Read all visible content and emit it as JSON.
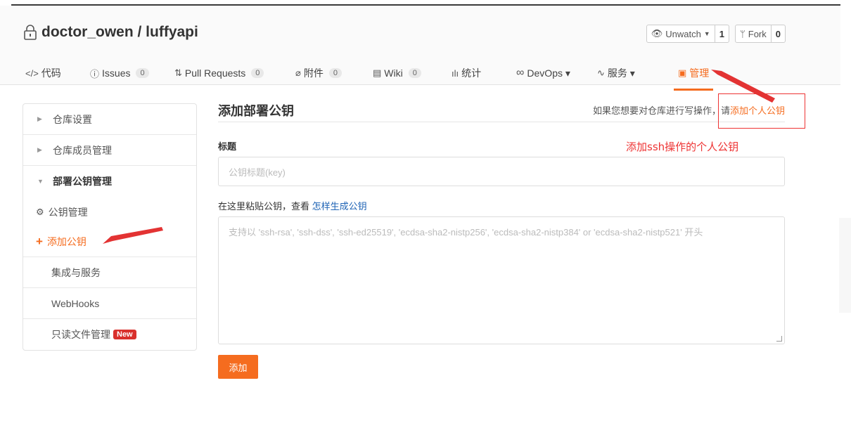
{
  "repo": {
    "owner_repo": "doctor_owen / luffyapi"
  },
  "actions": {
    "watch_label": "Unwatch",
    "watch_count": "1",
    "fork_label": "Fork",
    "fork_count": "0"
  },
  "tabs": [
    {
      "icon": "</>",
      "label": "代码"
    },
    {
      "icon": "ⓘ",
      "label": "Issues",
      "count": "0"
    },
    {
      "icon": "⇅",
      "label": "Pull Requests",
      "count": "0"
    },
    {
      "icon": "⌀",
      "label": "附件",
      "count": "0"
    },
    {
      "icon": "▤",
      "label": "Wiki",
      "count": "0"
    },
    {
      "icon": "ılı",
      "label": "统计"
    },
    {
      "icon": "∞",
      "label": "DevOps ▾"
    },
    {
      "icon": "∿",
      "label": "服务 ▾"
    },
    {
      "icon": "▣",
      "label": "管理"
    }
  ],
  "sidebar": {
    "repo_settings": "仓库设置",
    "repo_members": "仓库成员管理",
    "deploy_keys": "部署公钥管理",
    "key_manage": "公钥管理",
    "add_key": "添加公钥",
    "integrations": "集成与服务",
    "webhooks": "WebHooks",
    "readonly_files": "只读文件管理",
    "new_badge": "New"
  },
  "main": {
    "title": "添加部署公钥",
    "note_prefix": "如果您想要对仓库进行写操作，请",
    "note_link": "添加个人公钥",
    "title_label": "标题",
    "title_placeholder": "公钥标题(key)",
    "paste_prefix": "在这里粘贴公钥，查看",
    "paste_link": "怎样生成公钥",
    "textarea_placeholder": "支持以 'ssh-rsa', 'ssh-dss', 'ssh-ed25519', 'ecdsa-sha2-nistp256', 'ecdsa-sha2-nistp384' or 'ecdsa-sha2-nistp521' 开头",
    "submit_label": "添加"
  },
  "annotation": {
    "text": "添加ssh操作的个人公钥"
  },
  "colors": {
    "accent": "#f56c1f",
    "annotation": "#e33333",
    "link": "#1e63b5"
  }
}
